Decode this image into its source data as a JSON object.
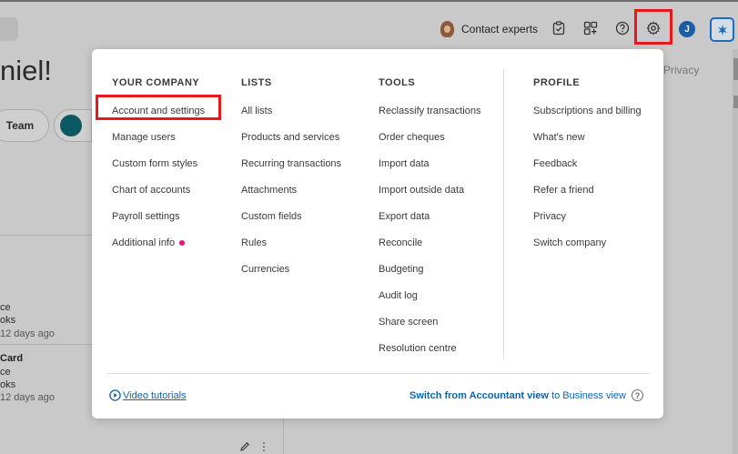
{
  "header": {
    "contact_experts": "Contact experts",
    "user_initial": "J",
    "highlight_color": "#e5181b"
  },
  "background": {
    "greeting": "niel!",
    "team_label": "Team",
    "privacy": "Privacy",
    "entries": [
      {
        "line1": "ce",
        "line2": "oks",
        "time": "12 days ago"
      },
      {
        "title": "Card",
        "line1": "ce",
        "line2": "oks",
        "time": "12 days ago"
      }
    ]
  },
  "menu": {
    "columns": [
      {
        "heading": "YOUR COMPANY",
        "items": [
          "Account and settings",
          "Manage users",
          "Custom form styles",
          "Chart of accounts",
          "Payroll settings",
          "Additional info"
        ]
      },
      {
        "heading": "LISTS",
        "items": [
          "All lists",
          "Products and services",
          "Recurring transactions",
          "Attachments",
          "Custom fields",
          "Rules",
          "Currencies"
        ]
      },
      {
        "heading": "TOOLS",
        "items": [
          "Reclassify transactions",
          "Order cheques",
          "Import data",
          "Import outside data",
          "Export data",
          "Reconcile",
          "Budgeting",
          "Audit log",
          "Share screen",
          "Resolution centre"
        ]
      },
      {
        "heading": "PROFILE",
        "items": [
          "Subscriptions and billing",
          "What's new",
          "Feedback",
          "Refer a friend",
          "Privacy",
          "Switch company"
        ]
      }
    ],
    "footer": {
      "video_tutorials": "Video tutorials",
      "switch_prefix": "Switch from Accountant view",
      "switch_suffix": "to Business view"
    },
    "link_color": "#0d63b4",
    "badge_color": "#e3127d"
  }
}
